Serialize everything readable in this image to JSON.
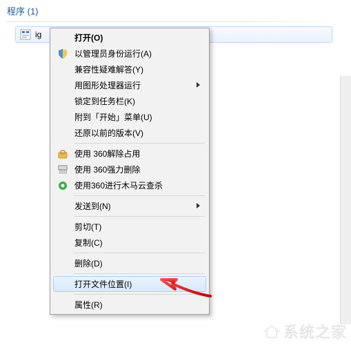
{
  "header": {
    "title": "程序 (1)"
  },
  "file": {
    "name_visible": "ig"
  },
  "menu": {
    "items": [
      {
        "label": "打开(O)",
        "icon": null,
        "default": true
      },
      {
        "label": "以管理员身份运行(A)",
        "icon": "shield-icon"
      },
      {
        "label": "兼容性疑难解答(Y)",
        "icon": null
      },
      {
        "label": "用图形处理器运行",
        "icon": null,
        "submenu": true
      },
      {
        "label": "锁定到任务栏(K)",
        "icon": null
      },
      {
        "label": "附到「开始」菜单(U)",
        "icon": null
      },
      {
        "label": "还原以前的版本(V)",
        "icon": null
      },
      {
        "sep": true
      },
      {
        "label": "使用 360解除占用",
        "icon": "unlock-360-icon"
      },
      {
        "label": "使用 360强力删除",
        "icon": "shred-360-icon"
      },
      {
        "label": "使用360进行木马云查杀",
        "icon": "scan-360-icon"
      },
      {
        "sep": true
      },
      {
        "label": "发送到(N)",
        "icon": null,
        "submenu": true
      },
      {
        "sep": true
      },
      {
        "label": "剪切(T)",
        "icon": null
      },
      {
        "label": "复制(C)",
        "icon": null
      },
      {
        "sep": true
      },
      {
        "label": "删除(D)",
        "icon": null
      },
      {
        "sep": true
      },
      {
        "label": "打开文件位置(I)",
        "icon": null,
        "hover": true
      },
      {
        "sep": true
      },
      {
        "label": "属性(R)",
        "icon": null
      }
    ]
  },
  "watermark": {
    "text": "系统之家"
  }
}
